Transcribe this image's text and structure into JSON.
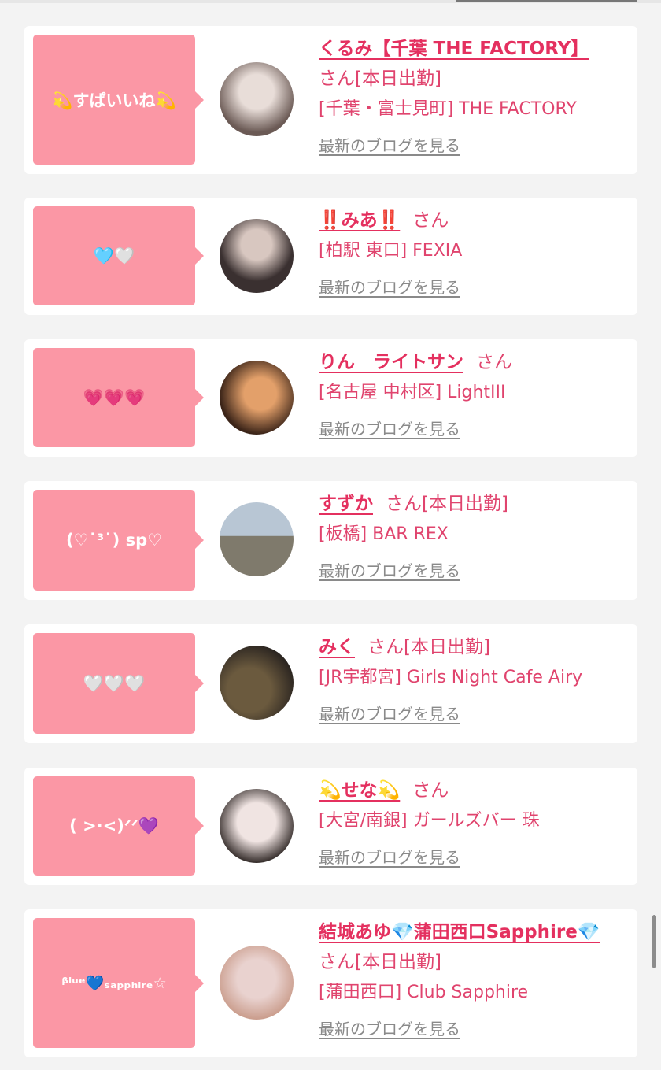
{
  "header": {
    "cut_text": "(...)"
  },
  "cards": [
    {
      "bubble": "💫すぱいいね💫",
      "name": "くるみ【千葉 THE FACTORY】",
      "san": "さん",
      "status": "[本日出勤]",
      "shop": "[千葉・富士見町] THE FACTORY",
      "blog": "最新のブログを見る",
      "avatar_colors": [
        "#e8ddd8",
        "#6b5a55"
      ]
    },
    {
      "bubble": "🩵🤍",
      "name": "‼️みあ‼️",
      "san": "さん",
      "status": "",
      "shop": "[柏駅 東口] FEXIA",
      "blog": "最新のブログを見る",
      "avatar_colors": [
        "#3a3030",
        "#d8c7c0"
      ]
    },
    {
      "bubble": "💗💗💗",
      "name": "りん　ライトサン",
      "san": "さん",
      "status": "",
      "shop": "[名古屋 中村区] LightIII",
      "blog": "最新のブログを見る",
      "avatar_colors": [
        "#3b2418",
        "#e3a06a"
      ]
    },
    {
      "bubble": "(♡˙³˙) sp♡",
      "name": "すずか",
      "san": "さん",
      "status": "[本日出勤]",
      "shop": "[板橋] BAR REX",
      "blog": "最新のブログを見る",
      "avatar_colors": [
        "#b8c6d4",
        "#7f7a6c"
      ]
    },
    {
      "bubble": "🤍🤍🤍",
      "name": "みく",
      "san": "さん",
      "status": "[本日出勤]",
      "shop": "[JR宇都宮] Girls Night Cafe Airy",
      "blog": "最新のブログを見る",
      "avatar_colors": [
        "#6b5a3e",
        "#2a2420"
      ]
    },
    {
      "bubble": "( >·<)ᐟᐟ💜",
      "name": "💫せな💫",
      "san": "さん",
      "status": "",
      "shop": "[大宮/南銀] ガールズバー 珠",
      "blog": "最新のブログを見る",
      "avatar_colors": [
        "#f0e4e2",
        "#2e2624"
      ]
    },
    {
      "bubble": "ᵝˡᵘᵉ💙ₛₐₚₚₕᵢᵣₑ☆",
      "name": "結城あゆ💎蒲田西口Sapphire💎",
      "san": "さん",
      "status": "[本日出勤]",
      "shop": "[蒲田西口] Club Sapphire",
      "blog": "最新のブログを見る",
      "avatar_colors": [
        "#e9d2cf",
        "#c99b8a"
      ]
    }
  ]
}
